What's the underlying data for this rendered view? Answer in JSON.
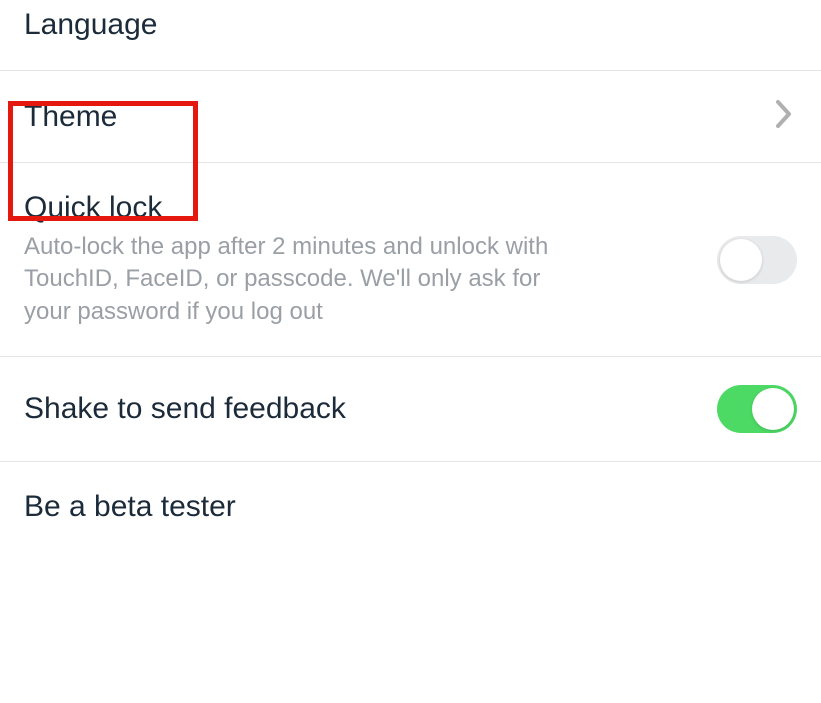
{
  "settings": {
    "language": {
      "label": "Language"
    },
    "theme": {
      "label": "Theme"
    },
    "quick_lock": {
      "label": "Quick lock",
      "description": "Auto-lock the app after 2 minutes and unlock with TouchID, FaceID, or passcode. We'll only ask for your password if you log out",
      "enabled": false
    },
    "shake_feedback": {
      "label": "Shake to send feedback",
      "enabled": true
    },
    "beta_tester": {
      "label": "Be a beta tester"
    }
  },
  "highlight": {
    "target": "theme"
  }
}
